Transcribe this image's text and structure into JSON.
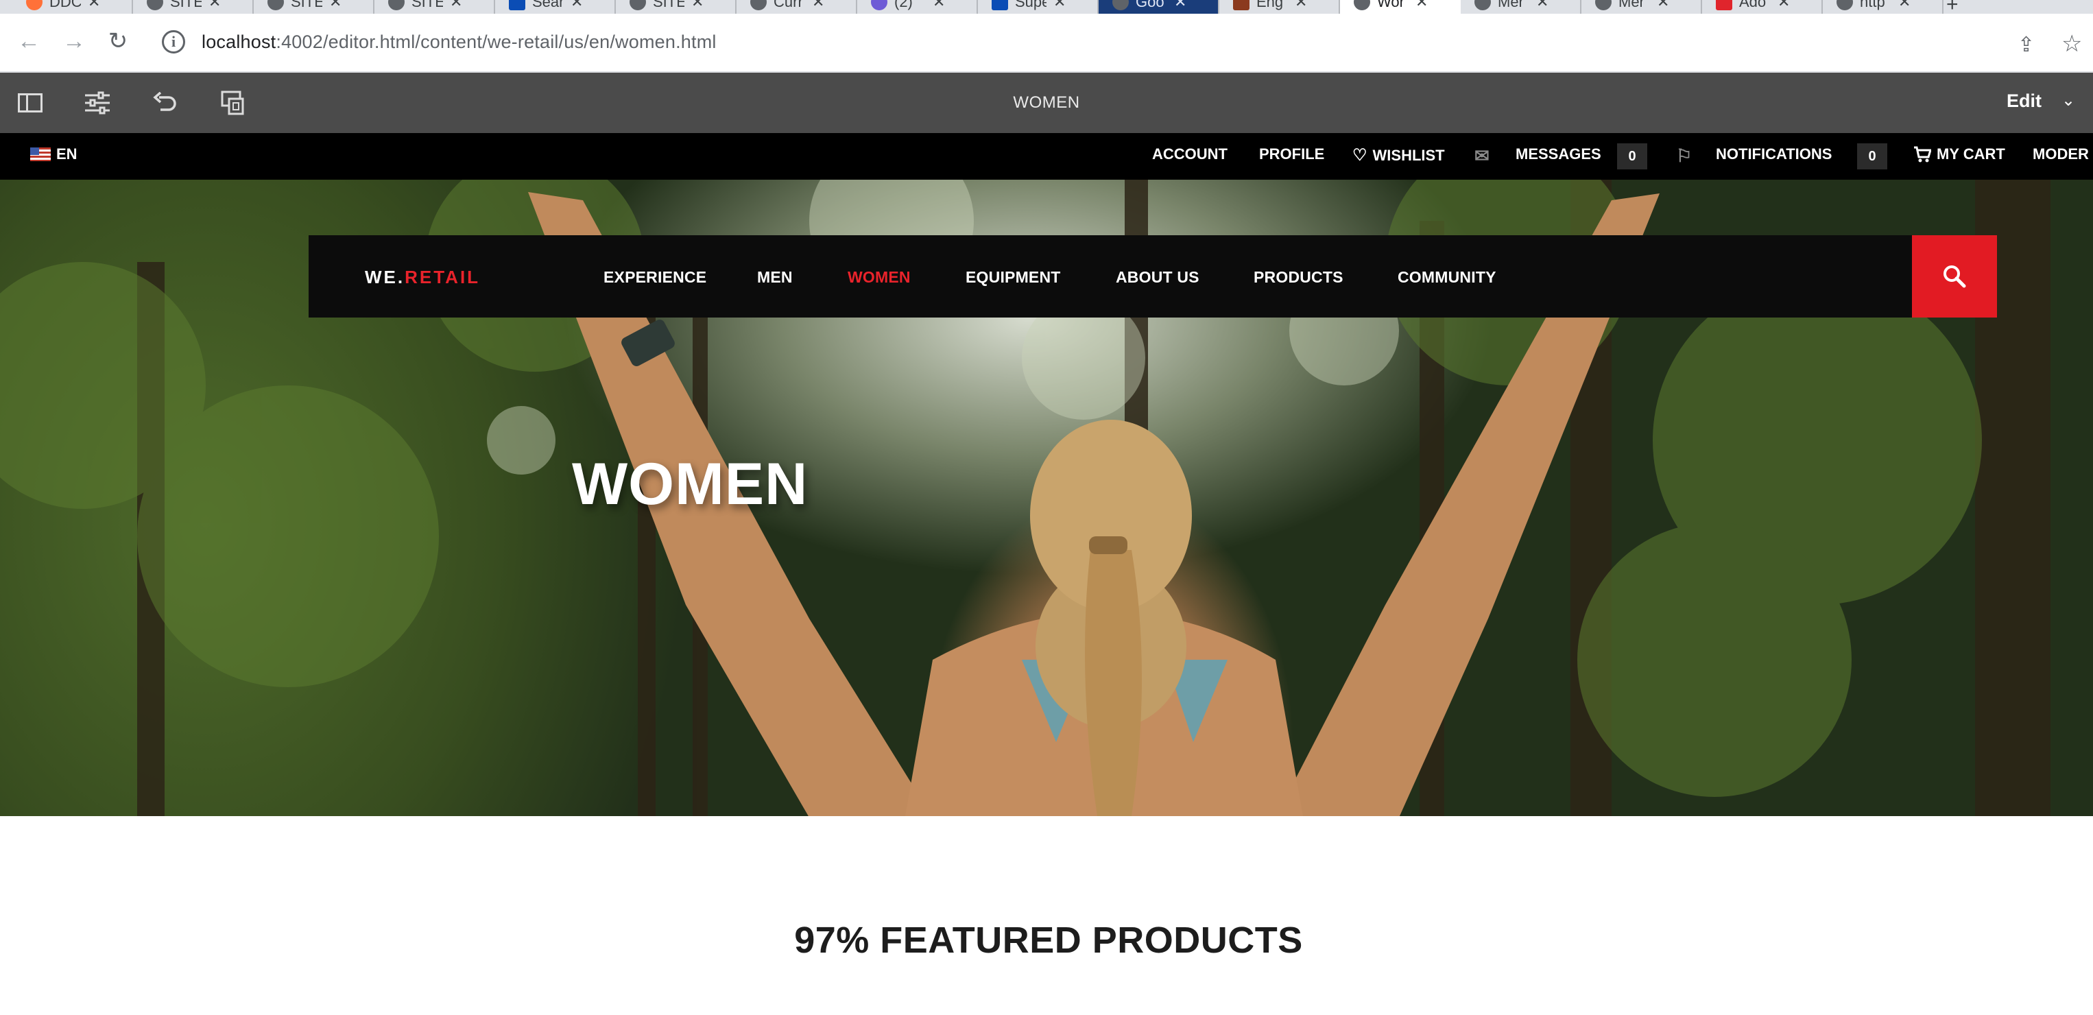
{
  "browser": {
    "tabs": [
      {
        "title": "DDC"
      },
      {
        "title": "SITE"
      },
      {
        "title": "SITE"
      },
      {
        "title": "SITE"
      },
      {
        "title": "Sear"
      },
      {
        "title": "SITE"
      },
      {
        "title": "Curr"
      },
      {
        "title": "(2) "
      },
      {
        "title": "Supe"
      },
      {
        "title": "Goo"
      },
      {
        "title": "Eng"
      },
      {
        "title": "Wor"
      },
      {
        "title": "Mer"
      },
      {
        "title": "Mer"
      },
      {
        "title": "Ado"
      },
      {
        "title": "http"
      }
    ],
    "url_host": "localhost",
    "url_rest": ":4002/editor.html/content/we-retail/us/en/women.html"
  },
  "editor": {
    "page_title": "WOMEN",
    "mode": "Edit"
  },
  "utility": {
    "language": "EN",
    "account": "ACCOUNT",
    "profile": "PROFILE",
    "wishlist": "WISHLIST",
    "messages": "MESSAGES",
    "messages_count": "0",
    "notifications": "NOTIFICATIONS",
    "notifications_count": "0",
    "cart": "MY CART",
    "moderation": "MODER"
  },
  "site": {
    "logo_prefix": "WE.",
    "logo_suffix": "RETAIL",
    "nav": [
      "EXPERIENCE",
      "MEN",
      "WOMEN",
      "EQUIPMENT",
      "ABOUT US",
      "PRODUCTS",
      "COMMUNITY"
    ],
    "active_nav": "WOMEN",
    "hero_title": "WOMEN",
    "featured_title": "97% FEATURED PRODUCTS"
  },
  "colors": {
    "brand_red": "#e9232b",
    "editor_bar": "#4b4b4b",
    "nav_bg": "#0c0c0c"
  }
}
